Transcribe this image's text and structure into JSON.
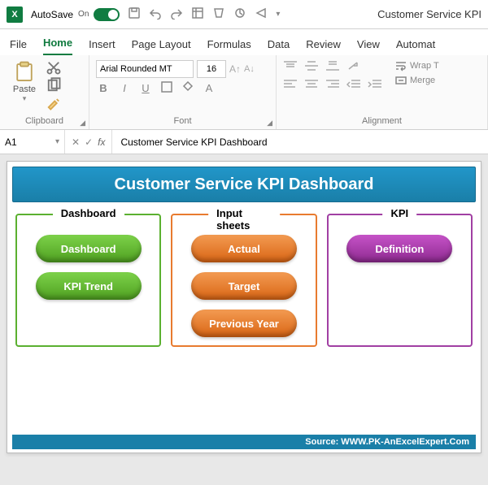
{
  "titlebar": {
    "autosave_label": "AutoSave",
    "autosave_state": "On",
    "doc_title": "Customer Service KPI"
  },
  "tabs": [
    "File",
    "Home",
    "Insert",
    "Page Layout",
    "Formulas",
    "Data",
    "Review",
    "View",
    "Automat"
  ],
  "active_tab": "Home",
  "ribbon": {
    "clipboard": {
      "label": "Clipboard",
      "paste_label": "Paste"
    },
    "font": {
      "label": "Font",
      "font_name": "Arial Rounded MT",
      "font_size": "16"
    },
    "alignment": {
      "label": "Alignment",
      "wrap_label": "Wrap T",
      "merge_label": "Merge"
    }
  },
  "formula_bar": {
    "cell_ref": "A1",
    "fx_label": "fx",
    "content": "Customer Service KPI Dashboard"
  },
  "dashboard": {
    "title": "Customer Service KPI Dashboard",
    "columns": [
      {
        "style": "green",
        "heading": "Dashboard",
        "buttons": [
          "Dashboard",
          "KPI Trend"
        ]
      },
      {
        "style": "orange",
        "heading": "Input sheets",
        "buttons": [
          "Actual",
          "Target",
          "Previous Year"
        ]
      },
      {
        "style": "purple",
        "heading": "KPI",
        "buttons": [
          "Definition"
        ]
      }
    ],
    "source_label": "Source: WWW.PK-AnExcelExpert.Com"
  }
}
